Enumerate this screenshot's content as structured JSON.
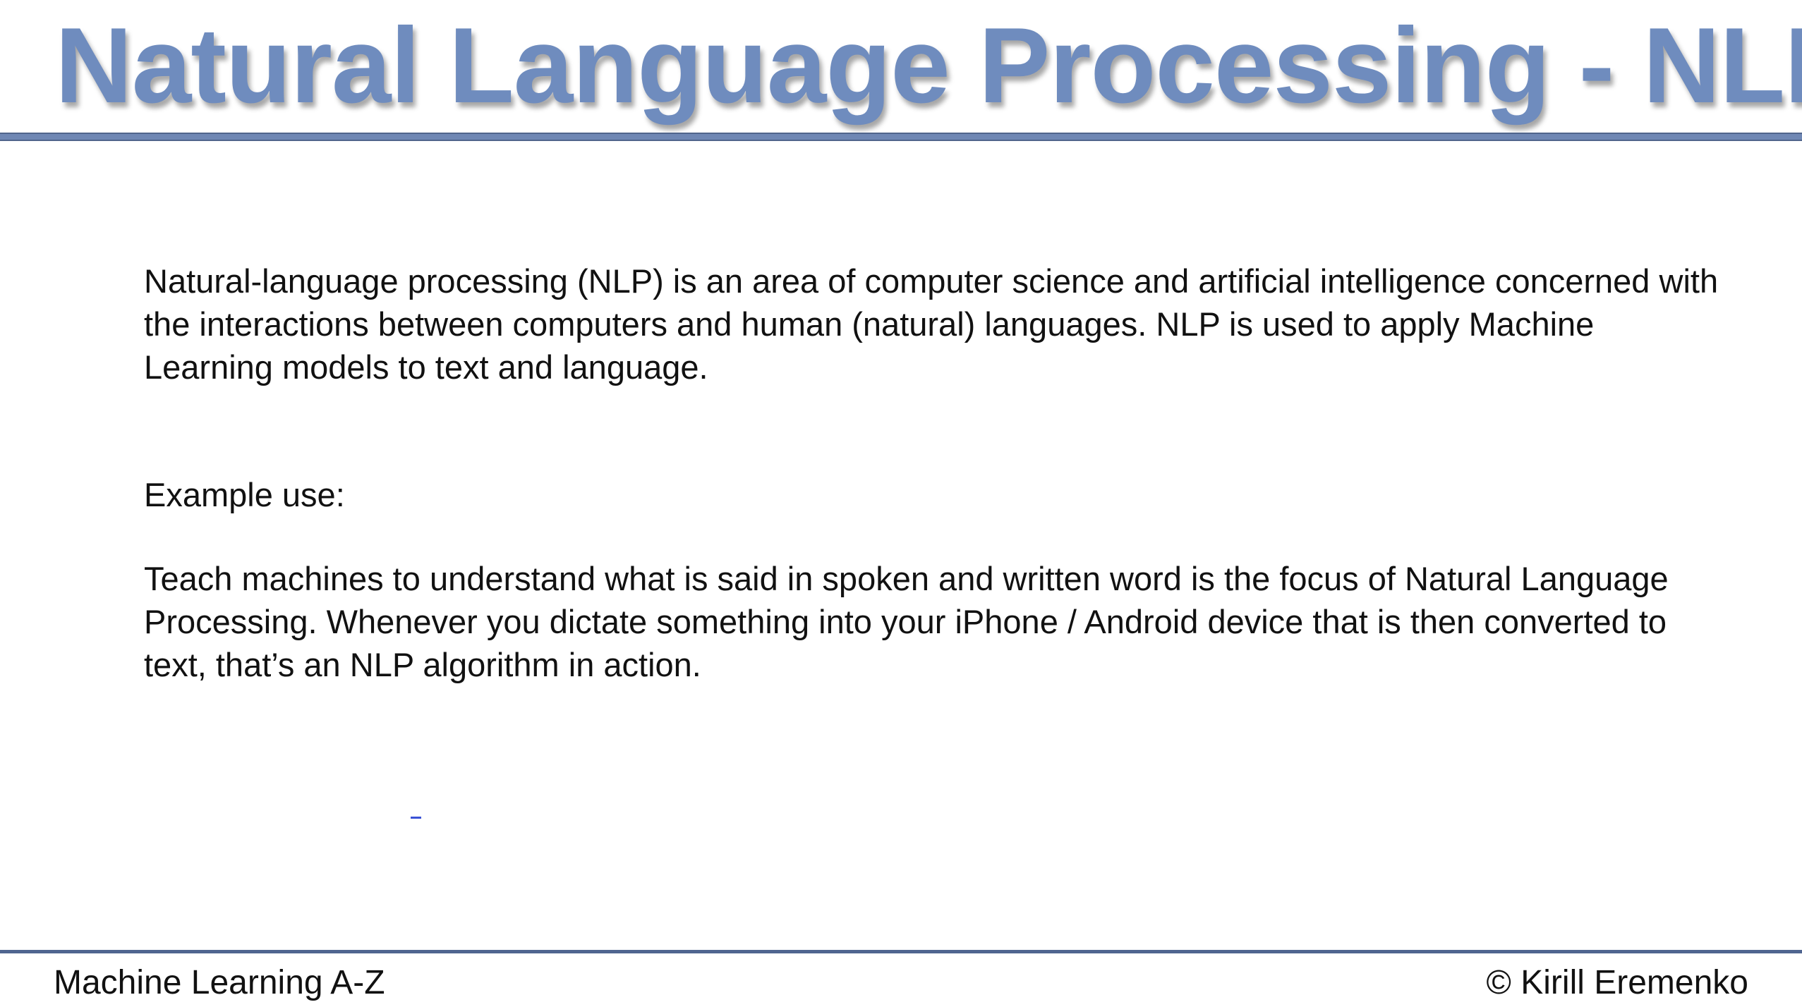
{
  "slide": {
    "title": "Natural Language Processing - NLP",
    "paragraph1": "Natural-language processing (NLP) is an area of computer science and artificial intelligence concerned with the interactions between computers and human (natural) languages. NLP is used to apply Machine Learning models to text and language.",
    "example_label": "Example use:",
    "paragraph2": "Teach machines to understand what is said in spoken and written word is the focus of Natural Language Processing. Whenever you dictate something into your iPhone / Android device that is then converted to text, that’s an NLP algorithm in action."
  },
  "footer": {
    "left": "Machine Learning A-Z",
    "right": "© Kirill Eremenko"
  },
  "colors": {
    "title": "#6f8cbe",
    "rule": "#6f87b4",
    "text": "#111111"
  }
}
